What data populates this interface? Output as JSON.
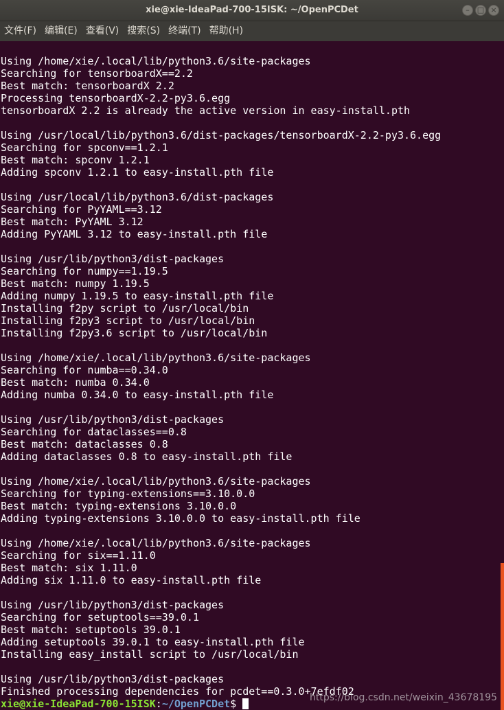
{
  "window": {
    "title": "xie@xie-IdeaPad-700-15ISK: ~/OpenPCDet",
    "controls": {
      "minimize": "–",
      "maximize": "□",
      "close": "×"
    }
  },
  "menu": [
    "文件(F)",
    "编辑(E)",
    "查看(V)",
    "搜索(S)",
    "终端(T)",
    "帮助(H)"
  ],
  "terminal": {
    "lines": [
      "Using /home/xie/.local/lib/python3.6/site-packages",
      "Searching for tensorboardX==2.2",
      "Best match: tensorboardX 2.2",
      "Processing tensorboardX-2.2-py3.6.egg",
      "tensorboardX 2.2 is already the active version in easy-install.pth",
      "",
      "Using /usr/local/lib/python3.6/dist-packages/tensorboardX-2.2-py3.6.egg",
      "Searching for spconv==1.2.1",
      "Best match: spconv 1.2.1",
      "Adding spconv 1.2.1 to easy-install.pth file",
      "",
      "Using /usr/local/lib/python3.6/dist-packages",
      "Searching for PyYAML==3.12",
      "Best match: PyYAML 3.12",
      "Adding PyYAML 3.12 to easy-install.pth file",
      "",
      "Using /usr/lib/python3/dist-packages",
      "Searching for numpy==1.19.5",
      "Best match: numpy 1.19.5",
      "Adding numpy 1.19.5 to easy-install.pth file",
      "Installing f2py script to /usr/local/bin",
      "Installing f2py3 script to /usr/local/bin",
      "Installing f2py3.6 script to /usr/local/bin",
      "",
      "Using /home/xie/.local/lib/python3.6/site-packages",
      "Searching for numba==0.34.0",
      "Best match: numba 0.34.0",
      "Adding numba 0.34.0 to easy-install.pth file",
      "",
      "Using /usr/lib/python3/dist-packages",
      "Searching for dataclasses==0.8",
      "Best match: dataclasses 0.8",
      "Adding dataclasses 0.8 to easy-install.pth file",
      "",
      "Using /home/xie/.local/lib/python3.6/site-packages",
      "Searching for typing-extensions==3.10.0.0",
      "Best match: typing-extensions 3.10.0.0",
      "Adding typing-extensions 3.10.0.0 to easy-install.pth file",
      "",
      "Using /home/xie/.local/lib/python3.6/site-packages",
      "Searching for six==1.11.0",
      "Best match: six 1.11.0",
      "Adding six 1.11.0 to easy-install.pth file",
      "",
      "Using /usr/lib/python3/dist-packages",
      "Searching for setuptools==39.0.1",
      "Best match: setuptools 39.0.1",
      "Adding setuptools 39.0.1 to easy-install.pth file",
      "Installing easy_install script to /usr/local/bin",
      "",
      "Using /usr/lib/python3/dist-packages",
      "Finished processing dependencies for pcdet==0.3.0+7efdf02"
    ],
    "prompt": {
      "user_host": "xie@xie-IdeaPad-700-15ISK",
      "separator": ":",
      "path": "~/OpenPCDet",
      "symbol": "$ "
    }
  },
  "watermark": "https://blog.csdn.net/weixin_43678195",
  "colors": {
    "background": "#300a24",
    "prompt_user": "#8ae234",
    "prompt_path": "#729fcf",
    "scroll_thumb": "#e95420"
  },
  "icons": {
    "minimize": "minimize-icon",
    "maximize": "maximize-icon",
    "close": "close-icon"
  }
}
